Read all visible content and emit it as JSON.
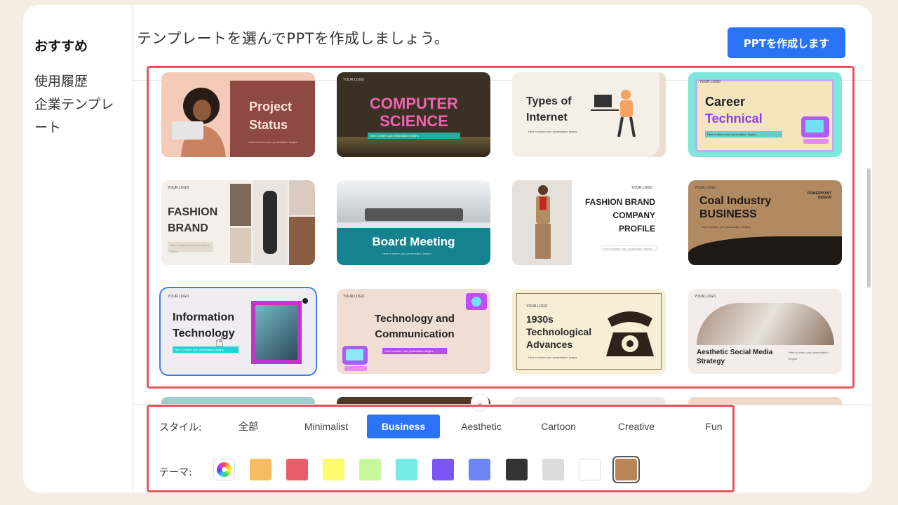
{
  "sidebar": {
    "items": [
      {
        "label": "おすすめ"
      },
      {
        "label": "使用履歴"
      },
      {
        "label": "企業テンプレート"
      }
    ]
  },
  "header": {
    "title": "テンプレートを選んでPPTを作成しましょう。",
    "create_button": "PPTを作成します"
  },
  "templates": [
    {
      "title": "Project Status",
      "logo": "",
      "subtitle": "Here is where your presentation begins"
    },
    {
      "title": "COMPUTER SCIENCE",
      "logo": "YOUR LOGO",
      "subtitle": "Here is where your presentation begins"
    },
    {
      "title": "Types of Internet",
      "logo": "",
      "subtitle": "Here is where your presentation begins"
    },
    {
      "title": "Career",
      "title2": "Technical",
      "logo": "YOUR LOGO",
      "subtitle": "Here is where your presentation begins"
    },
    {
      "title": "FASHION BRAND",
      "logo": "YOUR LOGO",
      "subtitle": "Here is where your presentation begins"
    },
    {
      "title": "Board Meeting",
      "logo": "",
      "subtitle": "Here is where your presentation begins"
    },
    {
      "title": "FASHION BRAND COMPANY PROFILE",
      "logo": "YOUR LOGO",
      "subtitle": "Here is where your presentation begins"
    },
    {
      "title": "Coal Industry BUSINESS",
      "logo": "YOUR LOGO",
      "tag": "POWERPOINT DESIGN",
      "subtitle": "Here is where your presentation begins"
    },
    {
      "title": "Information Technology",
      "logo": "YOUR LOGO",
      "subtitle": "Here is where your presentation begins"
    },
    {
      "title": "Technology and Communication",
      "logo": "YOUR LOGO",
      "subtitle": "Here is where your presentation begins"
    },
    {
      "title": "1930s Technological Advances",
      "logo": "YOUR LOGO",
      "subtitle": "Here is where your presentation begins"
    },
    {
      "title": "Aesthetic Social Media Strategy",
      "logo": "YOUR LOGO",
      "subtitle": "Here is where your presentation begins"
    }
  ],
  "filters": {
    "style_label": "スタイル:",
    "styles": [
      "全部",
      "Minimalist",
      "Business",
      "Aesthetic",
      "Cartoon",
      "Creative",
      "Fun"
    ],
    "selected_style": "Business",
    "theme_label": "テーマ:",
    "themes": [
      "#f5bd5f",
      "#eb5c6a",
      "#fbfb6b",
      "#c6f79b",
      "#74ece6",
      "#7b55f5",
      "#6d86f7",
      "#333333",
      "#dcdcdc",
      "#ffffff",
      "#b88458"
    ],
    "theme_icon": "color-wheel-icon",
    "selected_theme": "#b88458"
  },
  "colors": {
    "accent": "#2b73f5",
    "highlight_frame": "#e8555c"
  }
}
